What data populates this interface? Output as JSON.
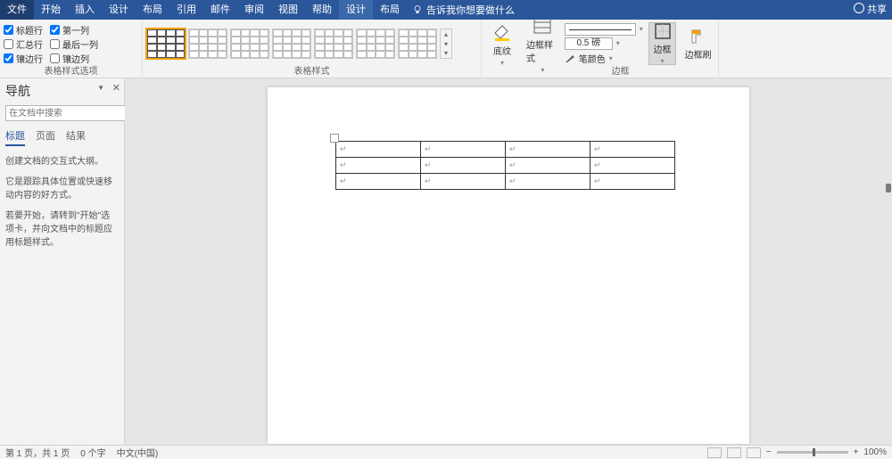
{
  "tabs": {
    "file": "文件",
    "items": [
      "开始",
      "插入",
      "设计",
      "布局",
      "引用",
      "邮件",
      "审阅",
      "视图",
      "帮助"
    ],
    "context": [
      "设计",
      "布局"
    ],
    "active_index": 0,
    "tell_me": "告诉我你想要做什么",
    "share": "共享"
  },
  "ribbon": {
    "tso": {
      "label": "表格样式选项",
      "header_row": "标题行",
      "first_col": "第一列",
      "total_row": "汇总行",
      "last_col": "最后一列",
      "banded_row": "镶边行",
      "banded_col": "镶边列",
      "checked": {
        "header_row": true,
        "first_col": true,
        "total_row": false,
        "last_col": false,
        "banded_row": true,
        "banded_col": false
      }
    },
    "styles": {
      "label": "表格样式",
      "count": 7
    },
    "shading": {
      "label": "底纹"
    },
    "borders": {
      "label": "边框",
      "style_btn": "边框样式",
      "weight": "0.5 磅",
      "pen": "笔颜色",
      "btn": "边框",
      "painter": "边框刷"
    }
  },
  "nav": {
    "title": "导航",
    "placeholder": "在文档中搜索",
    "tabs": [
      "标题",
      "页面",
      "结果"
    ],
    "active": 0,
    "p1": "创建文档的交互式大纲。",
    "p2": "它是跟踪具体位置或快速移动内容的好方式。",
    "p3": "若要开始，请转到\"开始\"选项卡，并向文档中的标题应用标题样式。"
  },
  "status": {
    "page": "第 1 页，共 1 页",
    "words": "0 个字",
    "lang": "中文(中国)",
    "zoom": "100%"
  },
  "watermark": ""
}
